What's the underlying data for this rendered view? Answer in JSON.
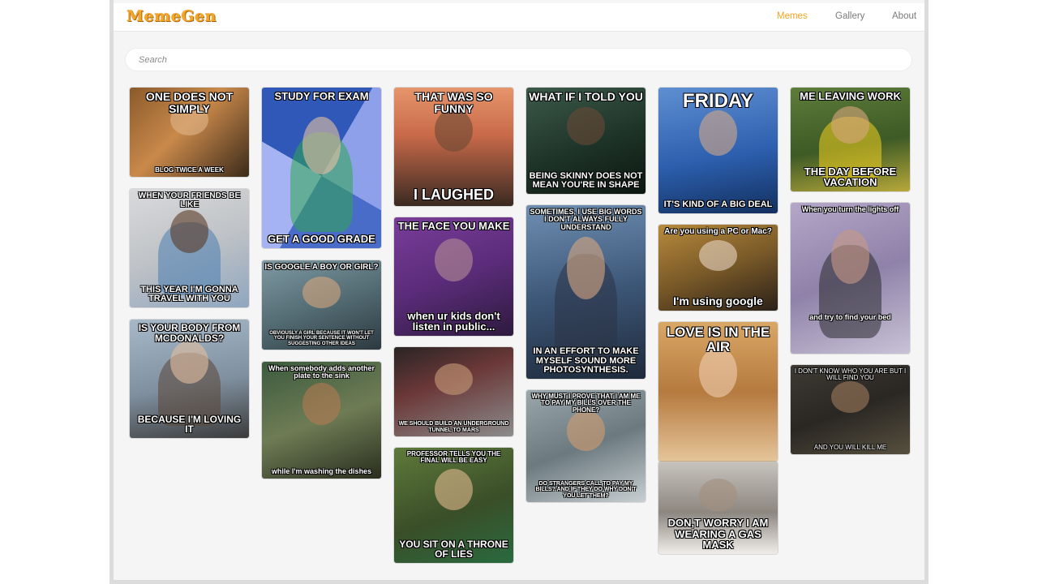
{
  "app": {
    "logo": "MemeGen"
  },
  "nav": {
    "memes": "Memes",
    "gallery": "Gallery",
    "about": "About"
  },
  "search": {
    "placeholder": "Search"
  },
  "colors": {
    "accent": "#f5a623",
    "nav_text": "#7a7a7a",
    "page_bg": "#f5f5f5"
  },
  "memes": [
    {
      "top": "ONE DOES NOT SIMPLY",
      "bottom": "BLOG TWICE A WEEK"
    },
    {
      "top": "WHEN YOUR FRIENDS BE LIKE",
      "bottom": "THIS YEAR I'M GONNA TRAVEL WITH YOU"
    },
    {
      "top": "IS YOUR BODY FROM MCDONALDS?",
      "bottom": "BECAUSE I'M LOVING IT"
    },
    {
      "top": "STUDY FOR EXAM",
      "bottom": "GET A GOOD GRADE"
    },
    {
      "top": "IS GOOGLE A BOY OR GIRL?",
      "bottom": "OBVIOUSLY A GIRL BECAUSE IT WON'T LET YOU FINISH YOUR SENTENCE WITHOUT SUGGESTING OTHER IDEAS"
    },
    {
      "top": "When somebody adds another plate to the sink",
      "bottom": "while I'm washing the dishes"
    },
    {
      "top": "THAT WAS SO FUNNY",
      "bottom": "I LAUGHED"
    },
    {
      "top": "THE FACE YOU MAKE",
      "bottom": "when ur kids don't listen in public..."
    },
    {
      "top": "",
      "bottom": "WE SHOULD BUILD AN UNDERGROUND TUNNEL TO MARS"
    },
    {
      "top": "PROFESSOR TELLS YOU THE FINAL WILL BE EASY",
      "bottom": "YOU SIT ON A THRONE OF LIES"
    },
    {
      "top": "WHAT IF I TOLD YOU",
      "bottom": "BEING SKINNY DOES NOT MEAN YOU'RE IN SHAPE"
    },
    {
      "top": "SOMETIMES, I USE BIG WORDS I DON'T ALWAYS FULLY UNDERSTAND",
      "bottom": "IN AN EFFORT TO MAKE MYSELF SOUND MORE PHOTOSYNTHESIS."
    },
    {
      "top": "WHY MUST I PROVE THAT I AM ME TO PAY MY BILLS OVER THE PHONE?",
      "bottom": "DO STRANGERS CALL TO PAY MY BILLS? AND IF THEY DO WHY DON'T YOU LET THEM?"
    },
    {
      "top": "FRIDAY",
      "bottom": "IT'S KIND OF A BIG DEAL"
    },
    {
      "top": "Are you using a PC or Mac?",
      "bottom": "I'm using google"
    },
    {
      "top": "LOVE IS IN THE AIR",
      "bottom": ""
    },
    {
      "top": "",
      "bottom": "DON,T WORRY I AM WEARING A GAS MASK"
    },
    {
      "top": "ME LEAVING WORK",
      "bottom": "THE DAY BEFORE VACATION"
    },
    {
      "top": "When you turn the lights off",
      "bottom": "and try to find your bed"
    },
    {
      "top": "I DON'T KNOW WHO YOU ARE BUT I WILL FIND YOU",
      "bottom": "AND YOU WILL KILL ME"
    }
  ]
}
